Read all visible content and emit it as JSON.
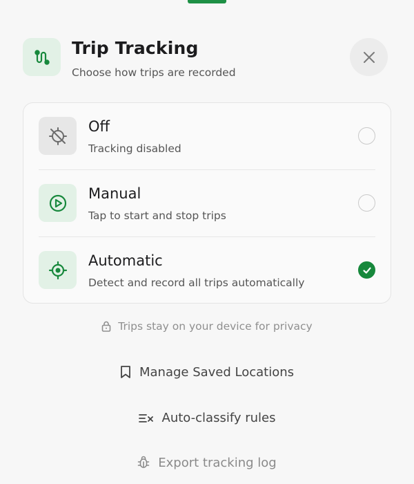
{
  "header": {
    "title": "Trip Tracking",
    "subtitle": "Choose how trips are recorded",
    "app_icon": "route-icon",
    "close_icon": "close-icon"
  },
  "options": [
    {
      "title": "Off",
      "description": "Tracking disabled",
      "icon": "location-off-icon",
      "selected": false
    },
    {
      "title": "Manual",
      "description": "Tap to start and stop trips",
      "icon": "play-circle-icon",
      "selected": false
    },
    {
      "title": "Automatic",
      "description": "Detect and record all trips automatically",
      "icon": "gps-target-icon",
      "selected": true
    }
  ],
  "privacy_note": "Trips stay on your device for privacy",
  "links": [
    {
      "label": "Manage Saved Locations",
      "icon": "bookmark-icon"
    },
    {
      "label": "Auto-classify rules",
      "icon": "list-check-icon"
    },
    {
      "label": "Export tracking log",
      "icon": "bug-icon"
    }
  ],
  "colors": {
    "accent": "#17883c",
    "accent_soft": "#e2f1e6",
    "background": "#f7f7f7"
  }
}
